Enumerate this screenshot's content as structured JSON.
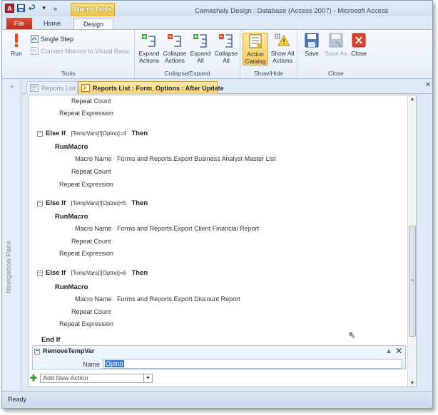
{
  "window": {
    "title": "Camashaly Design : Database (Access 2007) - Microsoft Access"
  },
  "qat": {
    "logo": "A",
    "save_icon": "save-icon",
    "undo_icon": "undo-icon"
  },
  "contextual_tab": "Macro Tools",
  "tabs": {
    "file": "File",
    "home": "Home",
    "design": "Design"
  },
  "ribbon": {
    "tools": {
      "label": "Tools",
      "run": "Run",
      "single_step": "Single Step",
      "convert": "Convert Macros to Visual Basic"
    },
    "collapse_expand": {
      "label": "Collapse/Expand",
      "expand_actions": "Expand Actions",
      "collapse_actions": "Collapse Actions",
      "expand_all": "Expand All",
      "collapse_all": "Collapse All"
    },
    "show_hide": {
      "label": "Show/Hide",
      "action_catalog": "Action Catalog",
      "show_all_actions": "Show All Actions"
    },
    "close": {
      "label": "Close",
      "save": "Save",
      "save_as": "Save As",
      "close": "Close"
    }
  },
  "nav_pane": {
    "label": "Navigation Pane",
    "toggle": "»"
  },
  "doc_tabs": [
    {
      "label": "Reports List"
    },
    {
      "label": "Reports List : Form_Options : After Update"
    }
  ],
  "macro": {
    "top_repeat_count": "Repeat Count",
    "top_repeat_expression": "Repeat Expression",
    "blocks": [
      {
        "keyword": "Else If",
        "condition": "[TempVars]![Optno]=4",
        "then": "Then",
        "action": "RunMacro",
        "macro_name_label": "Macro Name",
        "macro_name_value": "Forms and Reports.Export Business Analyst Master List",
        "repeat_count": "Repeat Count",
        "repeat_expression": "Repeat Expression"
      },
      {
        "keyword": "Else If",
        "condition": "[TempVars]![Optno]=5",
        "then": "Then",
        "action": "RunMacro",
        "macro_name_label": "Macro Name",
        "macro_name_value": "Forms and Reports.Export Client Financial Report",
        "repeat_count": "Repeat Count",
        "repeat_expression": "Repeat Expression"
      },
      {
        "keyword": "Else If",
        "condition": "[TempVars]![Optno]=6",
        "then": "Then",
        "action": "RunMacro",
        "macro_name_label": "Macro Name",
        "macro_name_value": "Forms and Reports.Export Discount Report",
        "repeat_count": "Repeat Count",
        "repeat_expression": "Repeat Expression"
      }
    ],
    "end_if": "End If",
    "remove_temp_var": {
      "action": "RemoveTempVar",
      "name_label": "Name",
      "name_value": "Optno"
    },
    "add_new_action": "Add New Action"
  },
  "status": "Ready",
  "colors": {
    "file_tab": "#c4402d",
    "contextual": "#e9c048",
    "active_doc_tab": "#f7cf6b"
  }
}
